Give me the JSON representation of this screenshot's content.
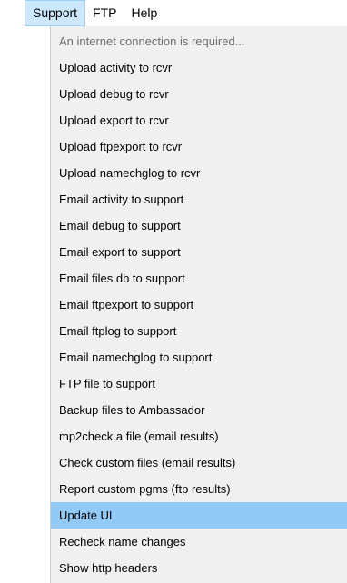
{
  "menubar": {
    "items": [
      {
        "label": "Support"
      },
      {
        "label": "FTP"
      },
      {
        "label": "Help"
      }
    ]
  },
  "support_menu": {
    "items": [
      {
        "label": "An internet connection is required..."
      },
      {
        "label": "Upload activity to rcvr"
      },
      {
        "label": "Upload debug to rcvr"
      },
      {
        "label": "Upload export to rcvr"
      },
      {
        "label": "Upload ftpexport to rcvr"
      },
      {
        "label": "Upload namechglog to rcvr"
      },
      {
        "label": "Email activity to support"
      },
      {
        "label": "Email debug to support"
      },
      {
        "label": "Email export to support"
      },
      {
        "label": "Email files db to support"
      },
      {
        "label": "Email ftpexport to support"
      },
      {
        "label": "Email ftplog to support"
      },
      {
        "label": "Email namechglog to support"
      },
      {
        "label": "FTP file to support"
      },
      {
        "label": "Backup files to Ambassador"
      },
      {
        "label": "mp2check a file (email results)"
      },
      {
        "label": "Check custom files (email results)"
      },
      {
        "label": "Report custom pgms (ftp results)"
      },
      {
        "label": "Update UI"
      },
      {
        "label": "Recheck name changes"
      },
      {
        "label": "Show http headers"
      }
    ]
  }
}
